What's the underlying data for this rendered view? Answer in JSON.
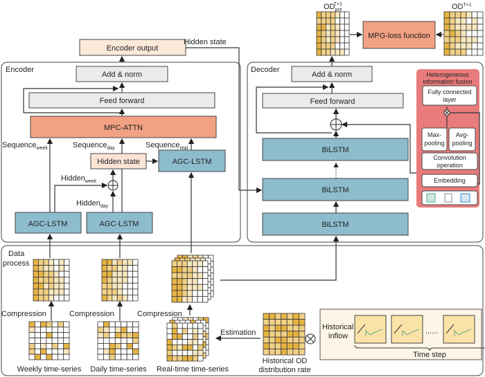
{
  "colors": {
    "attention": "#f2a283",
    "lstm": "#8dbccd",
    "norm": "#ebebeb",
    "hidden": "#fbe4d6",
    "fusion_panel": "#e87b7b",
    "cell_dark": "#e7b443",
    "cell_mid": "#f1d086",
    "cell_light": "#f8e8c0"
  },
  "top": {
    "od_pred": {
      "base": "OD",
      "sub": "pre",
      "sup": "T+1"
    },
    "od_true": {
      "base": "OD",
      "sup": "T+1"
    },
    "loss": "MPG-loss function",
    "encoder_output": "Encoder output",
    "hidden_state_link": "Hidden state"
  },
  "encoder": {
    "title": "Encoder",
    "add_norm": "Add & norm",
    "feed_forward": "Feed forward",
    "attention": "MPC-ATTN",
    "seq_week": {
      "base": "Sequence",
      "sub": "week"
    },
    "seq_day": {
      "base": "Sequence",
      "sub": "day"
    },
    "seq_real": {
      "base": "Sequence",
      "sub": "real"
    },
    "hidden_state": "Hidden state",
    "hidden_week": {
      "base": "Hidden",
      "sub": "week"
    },
    "hidden_day": {
      "base": "Hidden",
      "sub": "day"
    },
    "lstm_week": "AGC-LSTM",
    "lstm_day": "AGC-LSTM",
    "lstm_real": "AGC-LSTM"
  },
  "decoder": {
    "title": "Decoder",
    "add_norm": "Add & norm",
    "feed_forward": "Feed forward",
    "bilstm": [
      "BiLSTM",
      "BiLSTM",
      "BiLSTM"
    ],
    "fusion": {
      "title_line1": "Heterogeneous",
      "title_line2": "information fusion",
      "fc_line1": "Fully connected",
      "fc_line2": "layer",
      "max_line1": "Max-",
      "max_line2": "pooling",
      "avg_line1": "Avg-",
      "avg_line2": "pooling",
      "conv_line1": "Convolution",
      "conv_line2": "operation",
      "embedding": "Embedding",
      "input_icons": [
        "map-icon",
        "document-icon",
        "calendar-icon"
      ]
    }
  },
  "data_process": {
    "title_line1": "Data",
    "title_line2": "process",
    "compression": [
      "Compression",
      "Compression",
      "Compression"
    ],
    "weekly": "Weekly time-series",
    "daily": "Daily time-series",
    "realtime": "Real-time time-series",
    "estimation": "Estimation",
    "hist_od_line1": "Historical OD",
    "hist_od_line2": "distribution rate",
    "hist_inflow_line1": "Historical",
    "hist_inflow_line2": "inflow",
    "dots": "......",
    "time_step": "Time step"
  }
}
